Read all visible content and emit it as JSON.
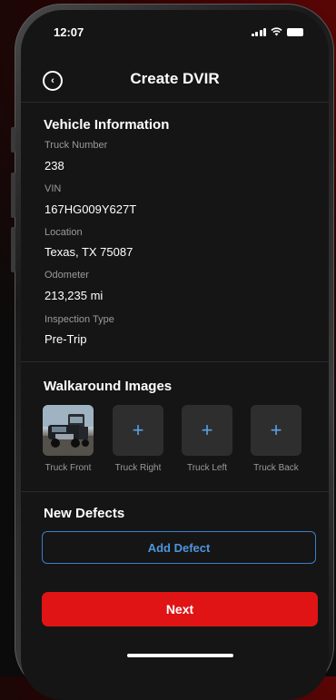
{
  "status_bar": {
    "time": "12:07"
  },
  "header": {
    "title": "Create DVIR",
    "back_icon": "back-arrow-circle-icon"
  },
  "vehicle_info": {
    "title": "Vehicle Information",
    "fields": [
      {
        "label": "Truck Number",
        "value": "238"
      },
      {
        "label": "VIN",
        "value": "167HG009Y627T"
      },
      {
        "label": "Location",
        "value": "Texas, TX 75087"
      },
      {
        "label": "Odometer",
        "value": "213,235 mi"
      },
      {
        "label": "Inspection Type",
        "value": "Pre-Trip"
      }
    ]
  },
  "walkaround": {
    "title": "Walkaround Images",
    "images": [
      {
        "label": "Truck Front",
        "state": "photo"
      },
      {
        "label": "Truck Right",
        "state": "empty",
        "icon": "+"
      },
      {
        "label": "Truck Left",
        "state": "empty",
        "icon": "+"
      },
      {
        "label": "Truck Back",
        "state": "empty",
        "icon": "+"
      }
    ]
  },
  "defects": {
    "title": "New Defects",
    "add_label": "Add Defect"
  },
  "footer": {
    "next_label": "Next"
  },
  "colors": {
    "accent_red": "#e01414",
    "accent_blue": "#4f95dc",
    "background": "#151515"
  }
}
